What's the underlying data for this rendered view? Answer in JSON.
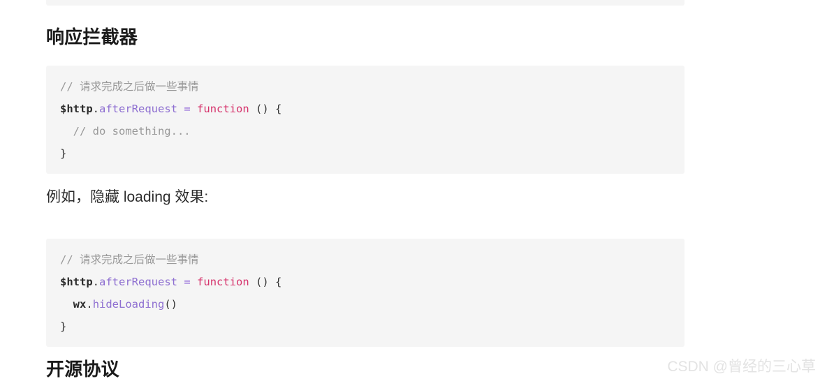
{
  "page": {
    "background_color": "#ffffff",
    "code_background_color": "#f5f5f5"
  },
  "headings": {
    "response_interceptor": "响应拦截器",
    "open_source_license": "开源协议"
  },
  "paragraphs": {
    "example_hide_loading": "例如，隐藏 loading 效果:"
  },
  "code_blocks": [
    {
      "id": "response-interceptor-snippet",
      "language": "javascript",
      "lines": [
        {
          "tokens": [
            {
              "text": "// 请求完成之后做一些事情",
              "type": "comment"
            }
          ]
        },
        {
          "tokens": [
            {
              "text": "$http",
              "type": "ident"
            },
            {
              "text": ".",
              "type": "punct"
            },
            {
              "text": "afterRequest",
              "type": "prop"
            },
            {
              "text": " ",
              "type": "plain"
            },
            {
              "text": "=",
              "type": "op"
            },
            {
              "text": " ",
              "type": "plain"
            },
            {
              "text": "function",
              "type": "keyword"
            },
            {
              "text": " () {",
              "type": "punct"
            }
          ]
        },
        {
          "tokens": [
            {
              "text": "  // do something...",
              "type": "comment"
            }
          ]
        },
        {
          "tokens": [
            {
              "text": "}",
              "type": "punct"
            }
          ]
        }
      ]
    },
    {
      "id": "hide-loading-snippet",
      "language": "javascript",
      "lines": [
        {
          "tokens": [
            {
              "text": "// 请求完成之后做一些事情",
              "type": "comment"
            }
          ]
        },
        {
          "tokens": [
            {
              "text": "$http",
              "type": "ident"
            },
            {
              "text": ".",
              "type": "punct"
            },
            {
              "text": "afterRequest",
              "type": "prop"
            },
            {
              "text": " ",
              "type": "plain"
            },
            {
              "text": "=",
              "type": "op"
            },
            {
              "text": " ",
              "type": "plain"
            },
            {
              "text": "function",
              "type": "keyword"
            },
            {
              "text": " () {",
              "type": "punct"
            }
          ]
        },
        {
          "tokens": [
            {
              "text": "  ",
              "type": "plain"
            },
            {
              "text": "wx",
              "type": "ident"
            },
            {
              "text": ".",
              "type": "punct"
            },
            {
              "text": "hideLoading",
              "type": "prop"
            },
            {
              "text": "()",
              "type": "punct"
            }
          ]
        },
        {
          "tokens": [
            {
              "text": "}",
              "type": "punct"
            }
          ]
        }
      ]
    }
  ],
  "watermark": {
    "text": "CSDN @曾经的三心草",
    "color": "#e3e3e3"
  },
  "colors": {
    "comment": "#999999",
    "identifier": "#2b2b2b",
    "property": "#8e6fd1",
    "operator": "#8b5fd6",
    "keyword": "#d6336c",
    "punctuation": "#333333",
    "heading": "#1a1a1a",
    "body_text": "#2b2b2b"
  }
}
